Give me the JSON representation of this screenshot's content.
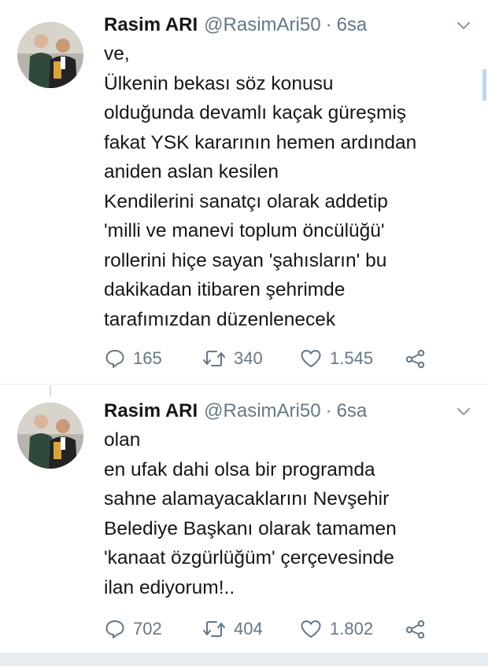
{
  "tweets": [
    {
      "author": {
        "name": "Rasim ARI",
        "handle": "@RasimAri50"
      },
      "separator": "·",
      "time": "6sa",
      "lines": [
        "ve,",
        "Ülkenin bekası söz konusu",
        "olduğunda devamlı kaçak güreşmiş",
        "fakat YSK kararının hemen ardından",
        "aniden aslan kesilen",
        "Kendilerini sanatçı olarak addetip",
        "'milli ve manevi toplum öncülüğü'",
        "rollerini hiçe sayan 'şahısların' bu",
        "dakikadan itibaren şehrimde",
        "tarafımızdan düzenlenecek"
      ],
      "stats": {
        "replies": "165",
        "retweets": "340",
        "likes": "1.545"
      }
    },
    {
      "author": {
        "name": "Rasim ARI",
        "handle": "@RasimAri50"
      },
      "separator": "·",
      "time": "6sa",
      "lines": [
        "olan",
        "en ufak dahi olsa bir programda",
        "sahne alamayacaklarını Nevşehir",
        "Belediye Başkanı olarak tamamen",
        "'kanaat özgürlüğüm' çerçevesinde",
        "ilan ediyorum!.."
      ],
      "stats": {
        "replies": "702",
        "retweets": "404",
        "likes": "1.802"
      }
    }
  ],
  "icons": {
    "reply": "reply-icon",
    "retweet": "retweet-icon",
    "like": "heart-icon",
    "share": "share-icon",
    "caret": "chevron-down-icon"
  },
  "colors": {
    "text": "#14171a",
    "secondary": "#657786",
    "divider": "#e6ecf0"
  }
}
